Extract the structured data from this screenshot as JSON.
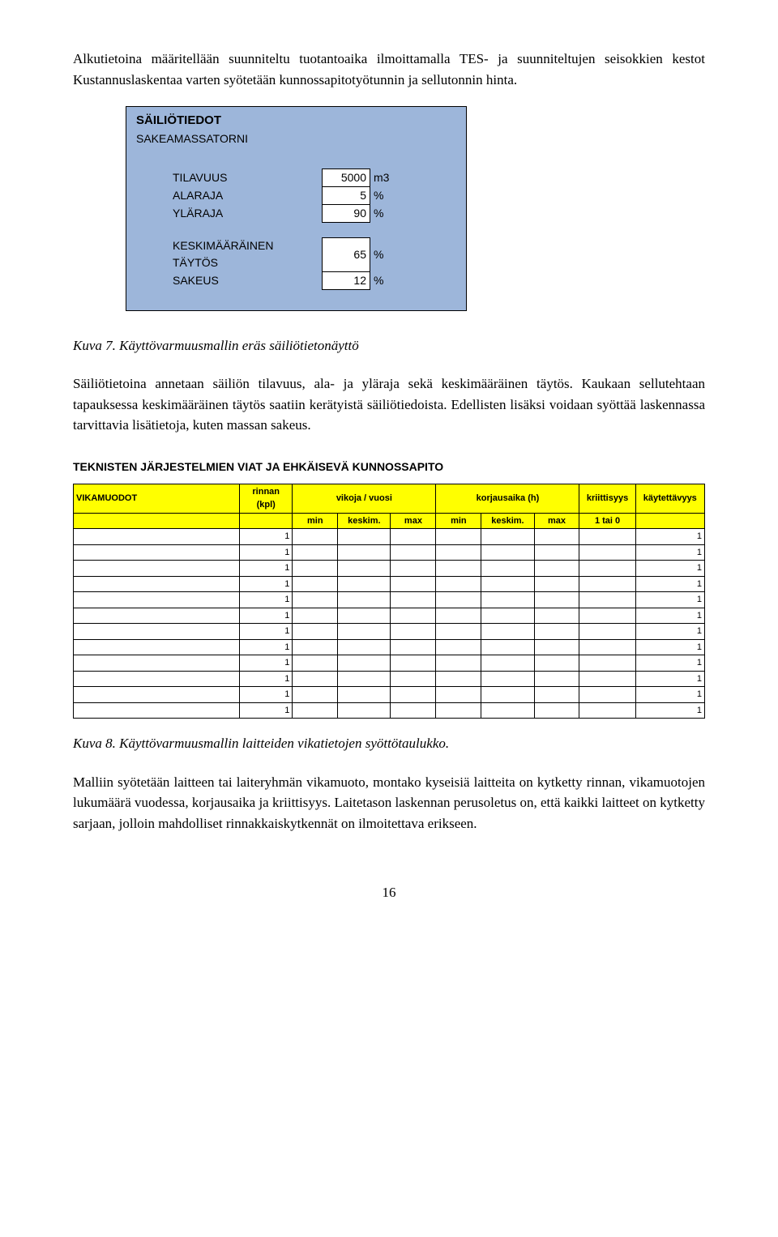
{
  "para1": "Alkutietoina määritellään suunniteltu tuotantoaika ilmoittamalla TES- ja suunniteltujen seisokkien kestot Kustannuslaskentaa varten syötetään kunnossapitotyötunnin ja sellutonnin hinta.",
  "box": {
    "title": "SÄILIÖTIEDOT",
    "subtitle": "SAKEAMASSATORNI",
    "rows": [
      {
        "label": "TILAVUUS",
        "value": "5000",
        "unit": "m3"
      },
      {
        "label": "ALARAJA",
        "value": "5",
        "unit": "%"
      },
      {
        "label": "YLÄRAJA",
        "value": "90",
        "unit": "%"
      }
    ],
    "rows2": [
      {
        "label": "KESKIMÄÄRÄINEN TÄYTÖS",
        "value": "65",
        "unit": "%"
      },
      {
        "label": "SAKEUS",
        "value": "12",
        "unit": "%"
      }
    ]
  },
  "caption1": "Kuva 7. Käyttövarmuusmallin eräs säiliötietonäyttö",
  "para2": "Säiliötietoina annetaan säiliön tilavuus, ala- ja yläraja sekä keskimääräinen täytös. Kaukaan sellutehtaan tapauksessa keskimääräinen täytös saatiin kerätyistä säiliötiedoista. Edellisten lisäksi voidaan syöttää laskennassa tarvittavia lisätietoja, kuten massan sakeus.",
  "tableHeader": "TEKNISTEN JÄRJESTELMIEN VIAT JA EHKÄISEVÄ KUNNOSSAPITO",
  "ftable": {
    "hd1": {
      "vikamuodot": "VIKAMUODOT",
      "rinnan": "rinnan (kpl)",
      "vikoja": "vikoja / vuosi",
      "korjaus": "korjausaika (h)",
      "kriit": "kriittisyys",
      "kaytt": "käytettävyys"
    },
    "hd2": {
      "min1": "min",
      "keskim1": "keskim.",
      "max1": "max",
      "min2": "min",
      "keskim2": "keskim.",
      "max2": "max",
      "tai": "1 tai 0"
    },
    "rows": 12,
    "rinnanVal": "1",
    "kayttVal": "1"
  },
  "caption2": "Kuva 8. Käyttövarmuusmallin laitteiden vikatietojen syöttötaulukko.",
  "para3": "Malliin syötetään laitteen tai laiteryhmän vikamuoto, montako kyseisiä laitteita on kytketty rinnan, vikamuotojen lukumäärä vuodessa, korjausaika ja kriittisyys. Laitetason laskennan perusoletus on, että kaikki laitteet on kytketty sarjaan, jolloin mahdolliset rinnakkaiskytkennät on ilmoitettava erikseen.",
  "pageNum": "16"
}
